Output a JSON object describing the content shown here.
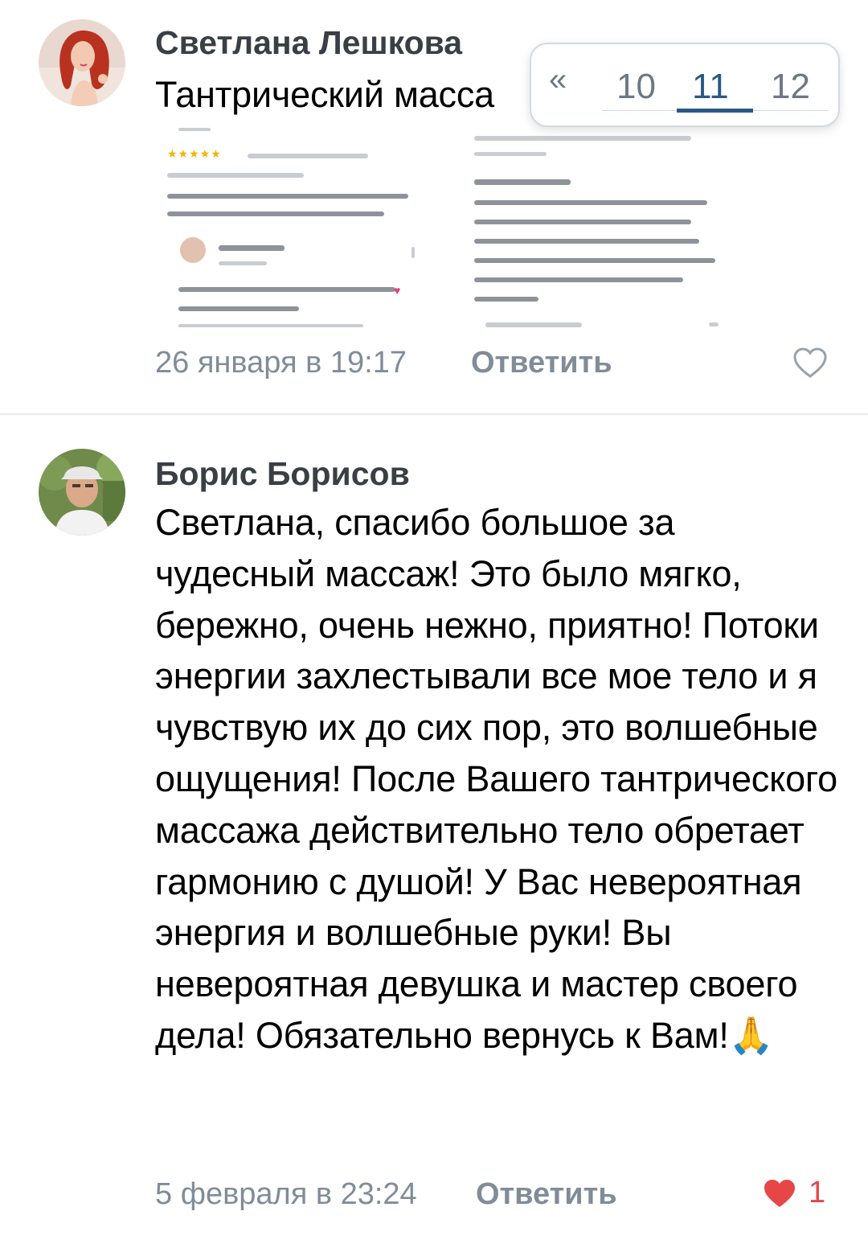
{
  "comments": [
    {
      "author": "Светлана Лешкова",
      "text": "Тантрический масса",
      "date": "26 января в 19:17",
      "reply_label": "Ответить",
      "likes": "",
      "liked": false
    },
    {
      "author": "Борис Борисов",
      "text": "Светлана, спасибо большое за чудесный массаж! Это было мягко, бережно, очень нежно, приятно! Потоки энергии захлестывали все мое тело и я чувствую их до сих пор, это волшебные ощущения! После Вашего тантрического массажа действительно тело обретает гармонию с душой! У Вас невероятная энергия и волшебные руки! Вы невероятная девушка и мастер своего дела! Обязательно вернусь к Вам!",
      "emoji": "🙏",
      "date": "5 февраля в 23:24",
      "reply_label": "Ответить",
      "likes": "1",
      "liked": true
    }
  ],
  "pager": {
    "prev_symbol": "«",
    "pages": [
      "10",
      "11",
      "12"
    ],
    "active_page": "11"
  },
  "colors": {
    "meta": "#818c99",
    "like_active": "#e64646",
    "pager_active": "#2a5885"
  },
  "icons": {
    "like_empty": "heart-outline-icon",
    "like_filled": "heart-filled-icon",
    "prev": "double-chevron-left-icon"
  }
}
